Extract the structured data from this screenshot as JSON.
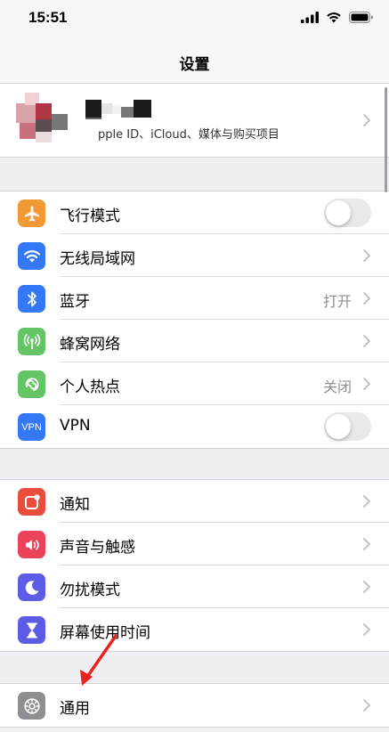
{
  "status": {
    "time": "15:51"
  },
  "nav": {
    "title": "设置"
  },
  "profile": {
    "subtitle": "pple ID、iCloud、媒体与购买项目"
  },
  "group1": [
    {
      "label": "飞行模式",
      "icon": "airplane-icon",
      "color": "#f19a37",
      "control": "toggle",
      "on": false
    },
    {
      "label": "无线局域网",
      "icon": "wifi-icon",
      "color": "#3478f6",
      "control": "chevron",
      "value": ""
    },
    {
      "label": "蓝牙",
      "icon": "bluetooth-icon",
      "color": "#3478f6",
      "control": "chevron",
      "value": "打开"
    },
    {
      "label": "蜂窝网络",
      "icon": "cellular-icon",
      "color": "#65c466",
      "control": "chevron",
      "value": ""
    },
    {
      "label": "个人热点",
      "icon": "hotspot-icon",
      "color": "#65c466",
      "control": "chevron",
      "value": "关闭"
    },
    {
      "label": "VPN",
      "icon": "vpn-icon",
      "icon_text": "VPN",
      "color": "#3478f6",
      "control": "toggle",
      "on": false
    }
  ],
  "group2": [
    {
      "label": "通知",
      "icon": "notifications-icon",
      "color": "#eb4d3d",
      "control": "chevron"
    },
    {
      "label": "声音与触感",
      "icon": "sounds-icon",
      "color": "#eb445a",
      "control": "chevron"
    },
    {
      "label": "勿扰模式",
      "icon": "do-not-disturb-icon",
      "color": "#5d5ce6",
      "control": "chevron"
    },
    {
      "label": "屏幕使用时间",
      "icon": "screen-time-icon",
      "color": "#5d5ce6",
      "control": "chevron"
    }
  ],
  "group3": [
    {
      "label": "通用",
      "icon": "gear-icon",
      "color": "#8e8e93",
      "control": "chevron"
    }
  ]
}
